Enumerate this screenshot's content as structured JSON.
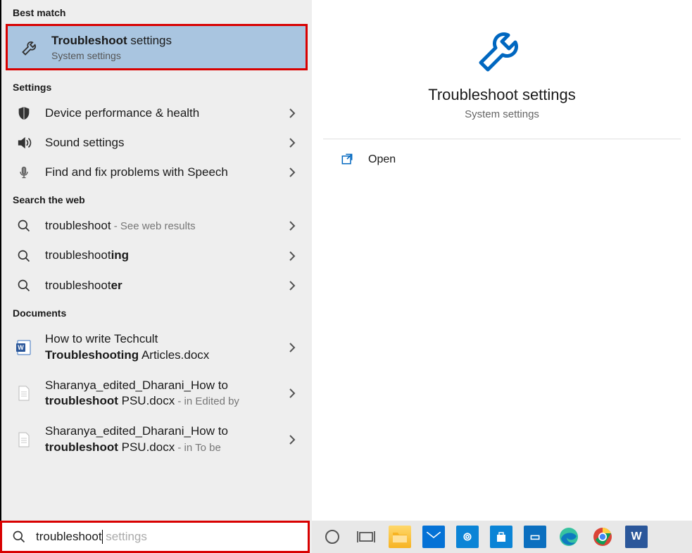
{
  "sections": {
    "best_match": "Best match",
    "settings": "Settings",
    "web": "Search the web",
    "documents": "Documents"
  },
  "best_match_item": {
    "title_bold": "Troubleshoot",
    "title_rest": " settings",
    "subtitle": "System settings"
  },
  "settings_items": [
    {
      "label": "Device performance & health",
      "icon": "shield"
    },
    {
      "label": "Sound settings",
      "icon": "sound"
    },
    {
      "label": "Find and fix problems with Speech",
      "icon": "mic"
    }
  ],
  "web_items": [
    {
      "prefix": "troubleshoot",
      "bold": "",
      "suffix": " - See web results",
      "show_suffix_muted": true
    },
    {
      "prefix": "troubleshoot",
      "bold": "ing",
      "suffix": ""
    },
    {
      "prefix": "troubleshoot",
      "bold": "er",
      "suffix": ""
    }
  ],
  "doc_items": [
    {
      "line1": "How to write Techcult",
      "line2_bold": "Troubleshooting",
      "line2_rest": " Articles.docx",
      "meta": "",
      "icon": "word"
    },
    {
      "line1": "Sharanya_edited_Dharani_How to",
      "line2_bold": "troubleshoot",
      "line2_rest": " PSU.docx",
      "meta": " - in Edited by",
      "icon": "file"
    },
    {
      "line1": "Sharanya_edited_Dharani_How to",
      "line2_bold": "troubleshoot",
      "line2_rest": " PSU.docx",
      "meta": " - in To be",
      "icon": "file"
    }
  ],
  "preview": {
    "title": "Troubleshoot settings",
    "subtitle": "System settings",
    "open_label": "Open"
  },
  "search": {
    "typed": "troubleshoot",
    "ghost": " settings"
  }
}
